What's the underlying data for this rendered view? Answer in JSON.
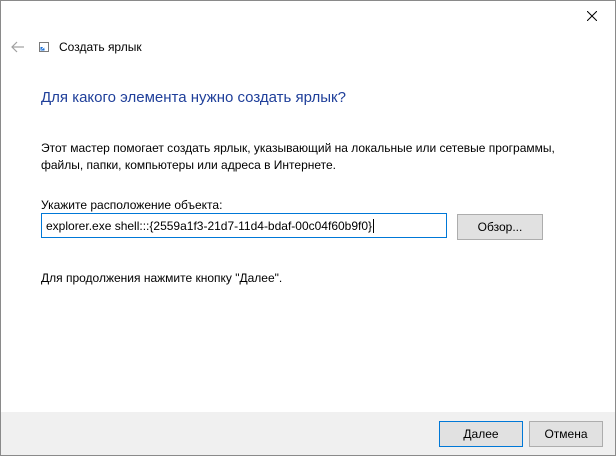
{
  "window": {
    "close_label": "✕"
  },
  "header": {
    "back_icon": "arrow-left-icon",
    "wizard_icon": "shortcut-icon",
    "title": "Создать ярлык"
  },
  "main": {
    "heading": "Для какого элемента нужно создать ярлык?",
    "description": "Этот мастер помогает создать ярлык, указывающий на локальные или сетевые программы, файлы, папки, компьютеры или адреса в Интернете.",
    "location_label": "Укажите расположение объекта:",
    "location_value": "explorer.exe shell:::{2559a1f3-21d7-11d4-bdaf-00c04f60b9f0}",
    "browse_label": "Обзор...",
    "continue_hint": "Для продолжения нажмите кнопку \"Далее\"."
  },
  "footer": {
    "next_label": "Далее",
    "cancel_label": "Отмена"
  },
  "colors": {
    "heading": "#1f3f9a",
    "accent": "#0078d7",
    "button_bg": "#e1e1e1",
    "footer_bg": "#f0f0f0"
  }
}
